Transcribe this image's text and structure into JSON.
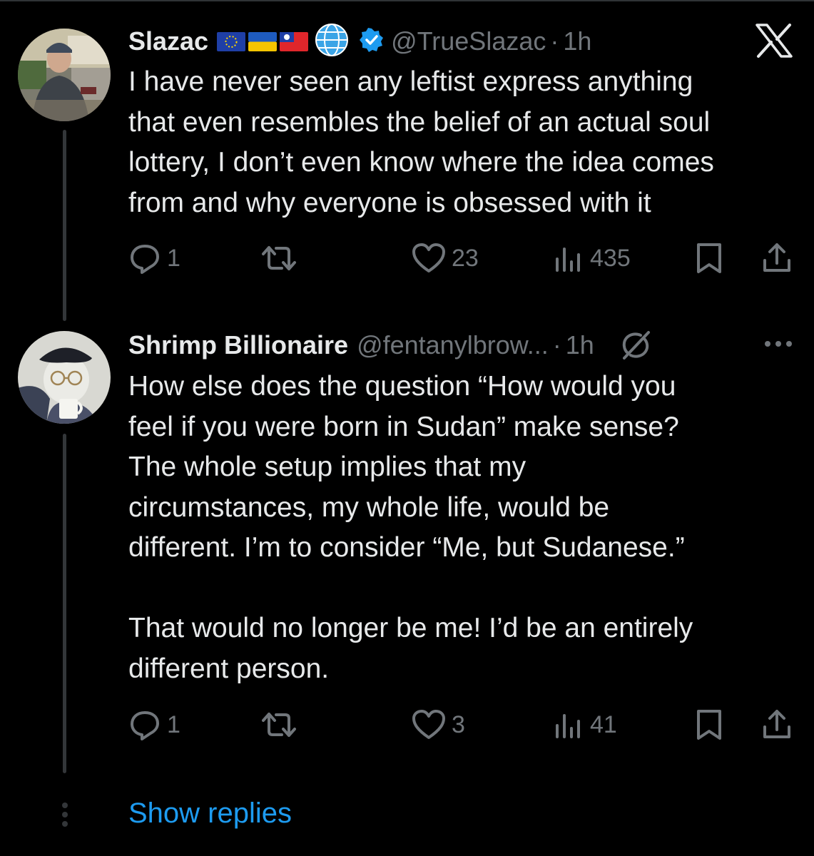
{
  "colors": {
    "background": "#000000",
    "text": "#e7e9ea",
    "secondary": "#71767b",
    "link": "#1d9bf0",
    "verified": "#1d9bf0",
    "thread_line": "#333639"
  },
  "platform_logo": "x-logo-icon",
  "tweets": [
    {
      "name": "Slazac",
      "badges": [
        "eu-flag-icon",
        "ukraine-flag-icon",
        "taiwan-flag-icon",
        "globe-icon",
        "verified-icon"
      ],
      "handle": "@TrueSlazac",
      "dot": "·",
      "time": "1h",
      "text": "I have never seen any leftist express anything\nthat even resembles the belief of an actual soul\nlottery, I don’t even know where the idea comes\nfrom and why everyone is obsessed with it",
      "replies": "1",
      "retweets": "",
      "likes": "23",
      "views": "435"
    },
    {
      "name": "Shrimp Billionaire",
      "handle": "@fentanylbrow...",
      "dot": "·",
      "time": "1h",
      "badges": [
        "grok-icon",
        "more-icon"
      ],
      "text": "How else does the question “How would you\nfeel if you were born in Sudan” make sense?\nThe whole setup implies that my\ncircumstances, my whole life, would be\ndifferent. I’m to consider “Me, but Sudanese.”\n\nThat would no longer be me! I’d be an entirely\ndifferent person.",
      "replies": "1",
      "retweets": "",
      "likes": "3",
      "views": "41"
    }
  ],
  "show_replies": "Show replies"
}
